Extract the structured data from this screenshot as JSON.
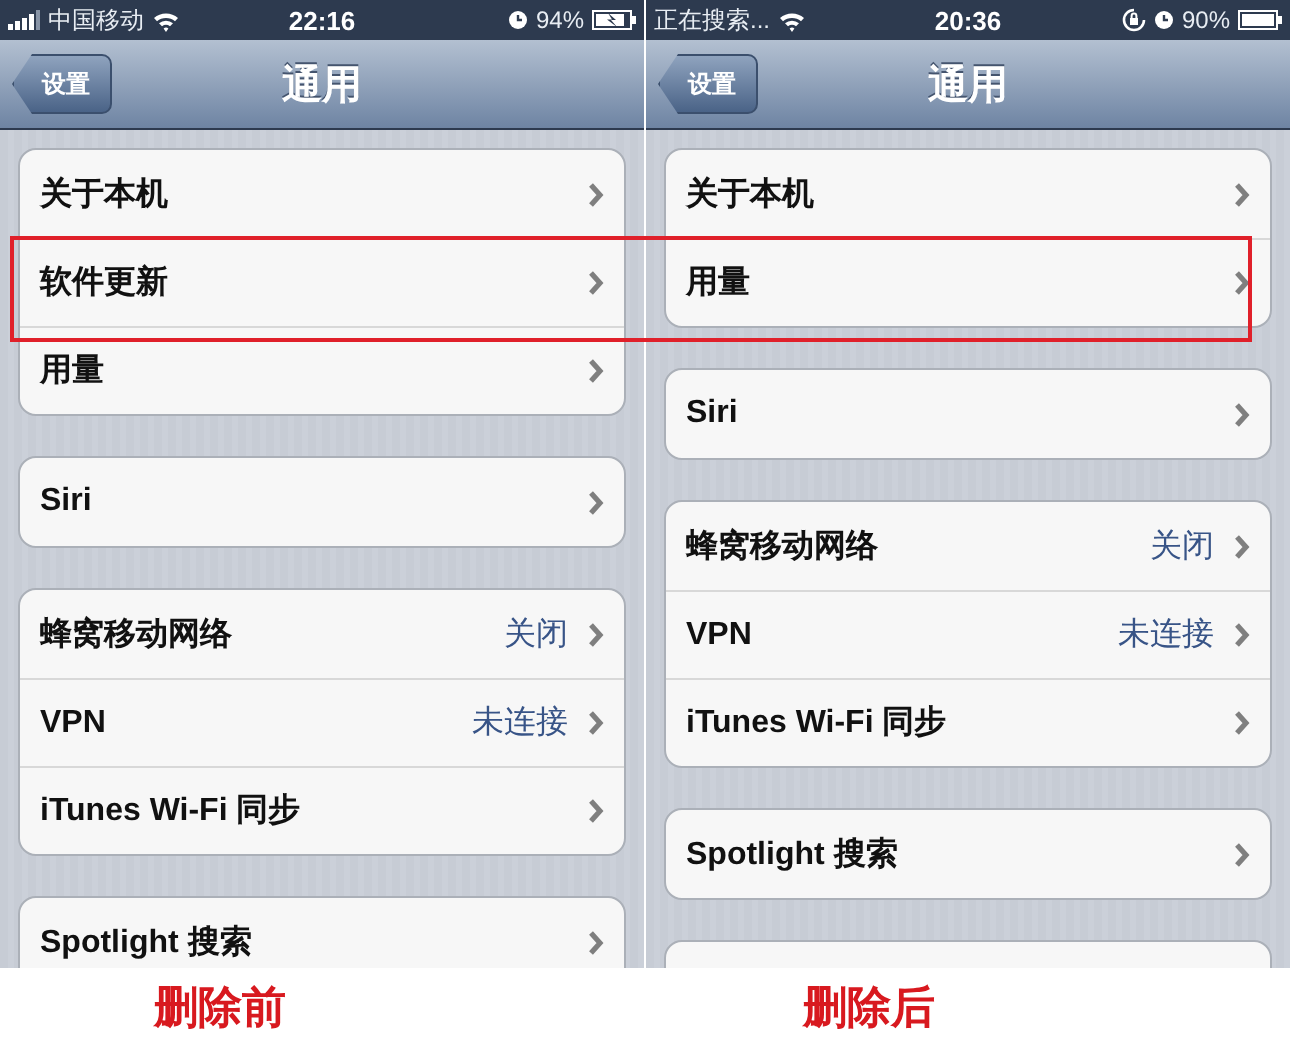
{
  "screens": [
    {
      "status": {
        "signal": true,
        "carrier": "中国移动",
        "time": "22:16",
        "rotation_lock": false,
        "battery": "94%",
        "charging": true
      },
      "nav": {
        "back": "设置",
        "title": "通用"
      },
      "groups": [
        {
          "rows": [
            {
              "label": "关于本机"
            },
            {
              "label": "软件更新"
            },
            {
              "label": "用量"
            }
          ]
        },
        {
          "rows": [
            {
              "label": "Siri"
            }
          ]
        },
        {
          "rows": [
            {
              "label": "蜂窝移动网络",
              "value": "关闭"
            },
            {
              "label": "VPN",
              "value": "未连接"
            },
            {
              "label": "iTunes Wi-Fi 同步"
            }
          ]
        },
        {
          "rows": [
            {
              "label": "Spotlight 搜索"
            }
          ]
        }
      ],
      "more_below": false
    },
    {
      "status": {
        "signal": false,
        "carrier": "正在搜索...",
        "time": "20:36",
        "rotation_lock": true,
        "battery": "90%",
        "charging": false
      },
      "nav": {
        "back": "设置",
        "title": "通用"
      },
      "groups": [
        {
          "rows": [
            {
              "label": "关于本机"
            },
            {
              "label": "用量"
            }
          ]
        },
        {
          "rows": [
            {
              "label": "Siri"
            }
          ]
        },
        {
          "rows": [
            {
              "label": "蜂窝移动网络",
              "value": "关闭"
            },
            {
              "label": "VPN",
              "value": "未连接"
            },
            {
              "label": "iTunes Wi-Fi 同步"
            }
          ]
        },
        {
          "rows": [
            {
              "label": "Spotlight 搜索"
            }
          ]
        }
      ],
      "more_below": true
    }
  ],
  "captions": [
    "删除前",
    "删除后"
  ],
  "highlight": true
}
